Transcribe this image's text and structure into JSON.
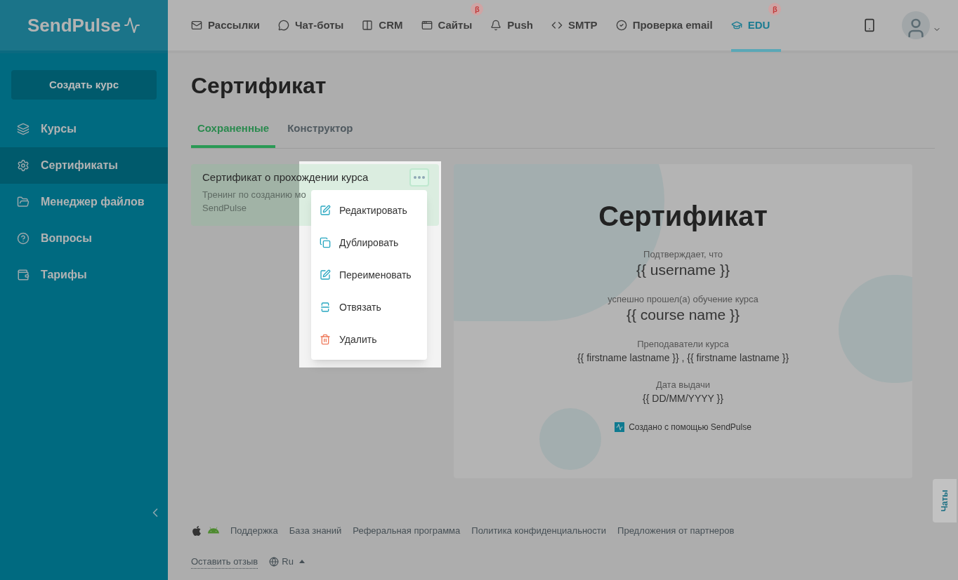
{
  "logo": "SendPulse",
  "nav": [
    {
      "kind": "mail",
      "label": "Рассылки",
      "selected": false
    },
    {
      "kind": "chat",
      "label": "Чат-боты",
      "selected": false
    },
    {
      "kind": "crm",
      "label": "CRM",
      "selected": false
    },
    {
      "kind": "site",
      "label": "Сайты",
      "selected": false,
      "badge": "β"
    },
    {
      "kind": "bell",
      "label": "Push",
      "selected": false
    },
    {
      "kind": "code",
      "label": "SMTP",
      "selected": false
    },
    {
      "kind": "check",
      "label": "Проверка email",
      "selected": false
    },
    {
      "kind": "edu",
      "label": "EDU",
      "selected": true,
      "badge": "β"
    }
  ],
  "sidebar": {
    "button": "Создать курс",
    "items": [
      {
        "kind": "courses",
        "label": "Курсы",
        "selected": false
      },
      {
        "kind": "gear",
        "label": "Сертификаты",
        "selected": true
      },
      {
        "kind": "folder",
        "label": "Менеджер файлов",
        "selected": false
      },
      {
        "kind": "help",
        "label": "Вопросы",
        "selected": false
      },
      {
        "kind": "wallet",
        "label": "Тарифы",
        "selected": false
      }
    ]
  },
  "page_title": "Сертификат",
  "tabs": [
    {
      "label": "Сохраненные",
      "selected": true
    },
    {
      "label": "Конструктор",
      "selected": false
    }
  ],
  "card": {
    "title": "Сертификат о прохождении курса",
    "description": "Тренинг по созданию мо",
    "description_2": "SendPulse"
  },
  "menu": [
    {
      "kind": "edit",
      "label": "Редактировать"
    },
    {
      "kind": "copy",
      "label": "Дублировать"
    },
    {
      "kind": "edit",
      "label": "Переименовать"
    },
    {
      "kind": "unlink",
      "label": "Отвязать"
    },
    {
      "kind": "delete",
      "label": "Удалить"
    }
  ],
  "certificate": {
    "title": "Сертификат",
    "lines": [
      {
        "kind": "label",
        "text": "Подтверждает, что"
      },
      {
        "kind": "big",
        "text": "{{ username }}"
      },
      {
        "kind": "label",
        "text": "успешно прошел(а) обучение курса"
      },
      {
        "kind": "big",
        "text": "{{ course name }}"
      },
      {
        "kind": "label",
        "text": "Преподаватели курса"
      },
      {
        "kind": "value",
        "text": "{{ firstname lastname }} , {{ firstname lastname }}"
      },
      {
        "kind": "label",
        "text": "Дата выдачи"
      },
      {
        "kind": "value",
        "text": "{{ DD/MM/YYYY }}"
      }
    ],
    "footer": "Создано с помощью SendPulse"
  },
  "chats_tab": "Чаты",
  "footer": {
    "links": [
      "Поддержка",
      "База знаний",
      "Реферальная программа",
      "Политика конфиденциальности",
      "Предложения от партнеров"
    ],
    "feedback": "Оставить отзыв",
    "language": "Ru"
  }
}
